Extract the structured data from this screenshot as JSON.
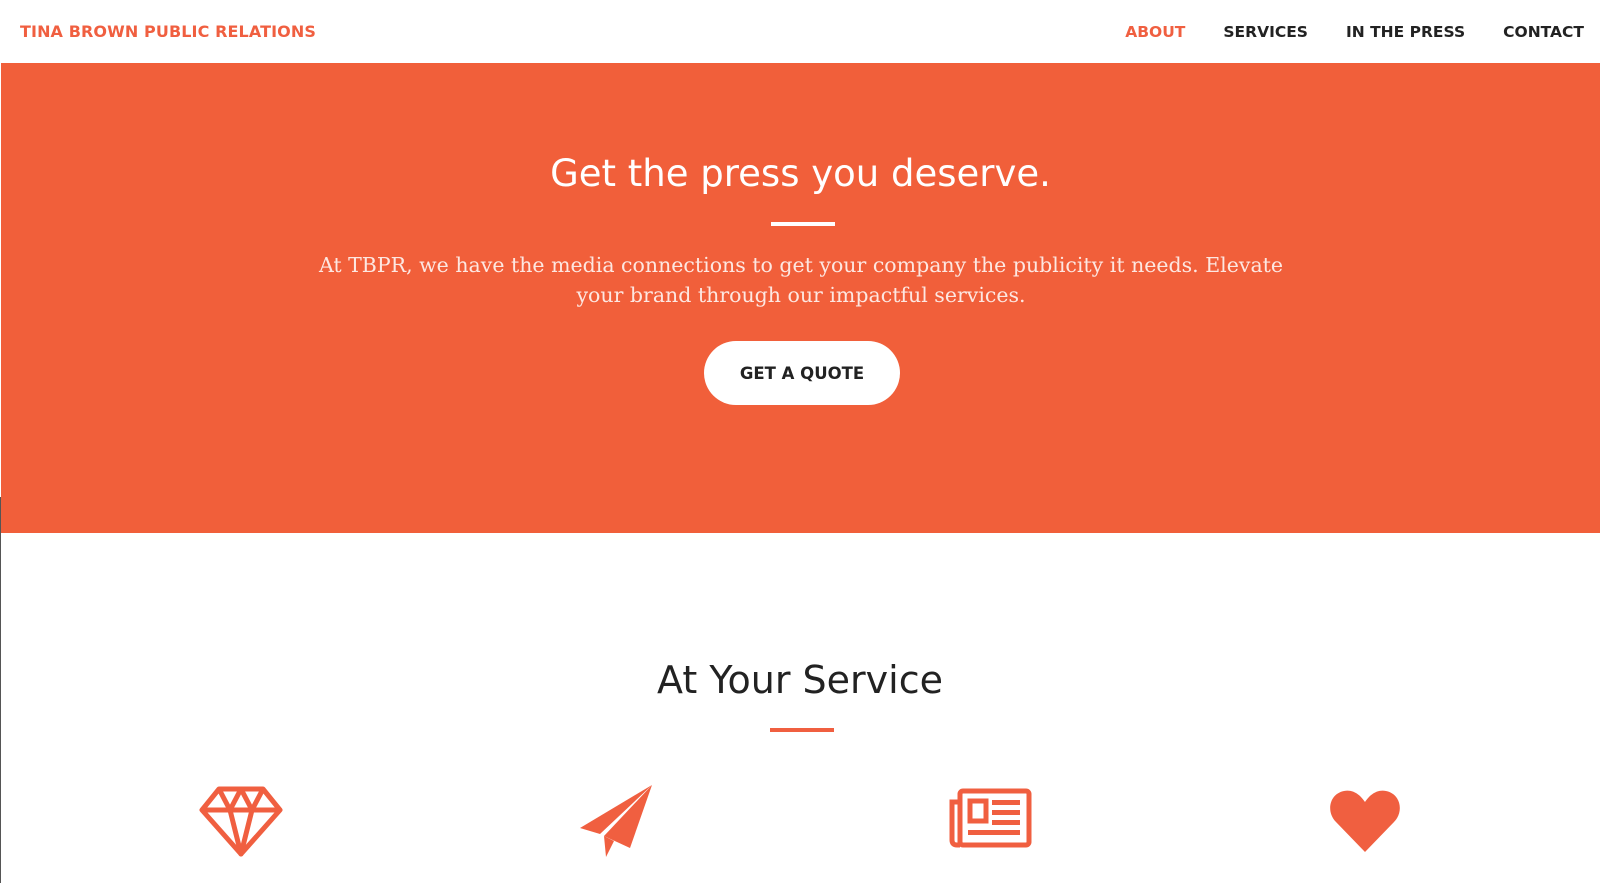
{
  "navbar": {
    "brand": "TINA BROWN PUBLIC RELATIONS",
    "links": [
      {
        "label": "ABOUT",
        "active": true
      },
      {
        "label": "SERVICES",
        "active": false
      },
      {
        "label": "IN THE PRESS",
        "active": false
      },
      {
        "label": "CONTACT",
        "active": false
      }
    ]
  },
  "hero": {
    "title": "Get the press you deserve.",
    "text": "At TBPR, we have the media connections to get your company the publicity it needs. Elevate your brand through our impactful services.",
    "button_label": "GET A QUOTE"
  },
  "services": {
    "title": "At Your Service",
    "icons": [
      "diamond-icon",
      "paper-plane-icon",
      "newspaper-icon",
      "heart-icon"
    ]
  },
  "colors": {
    "accent": "#F05F40",
    "hero_bg": "#F15F3A",
    "text_dark": "#222222"
  }
}
